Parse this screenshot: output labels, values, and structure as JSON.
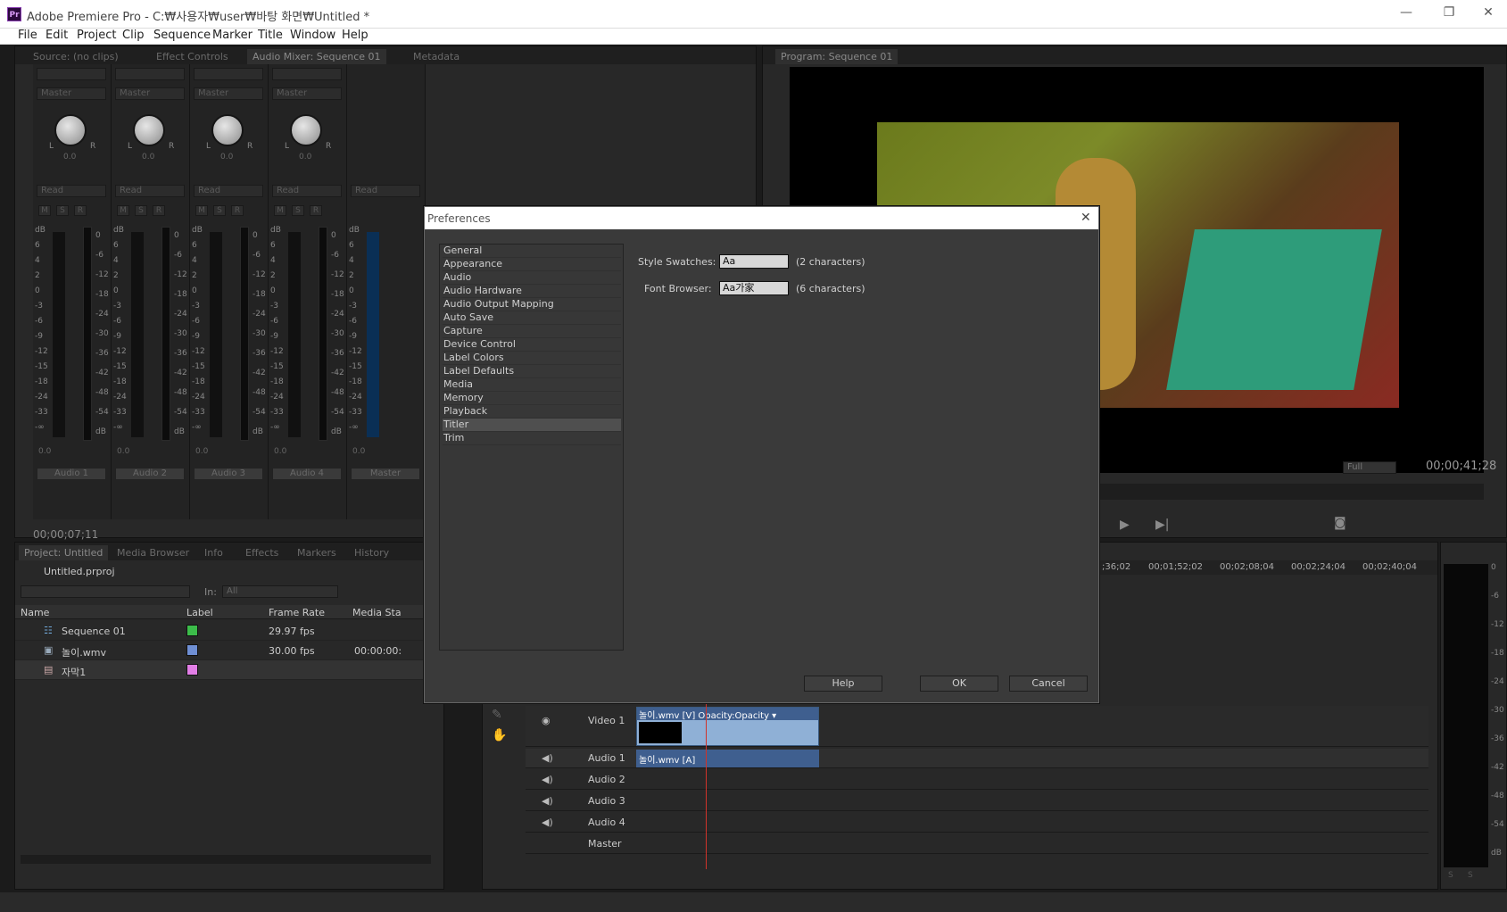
{
  "window": {
    "title": "Adobe Premiere Pro - C:₩사용자₩user₩바탕 화면₩Untitled *",
    "logo": "Pr",
    "minimize": "—",
    "restore": "❐",
    "close": "✕"
  },
  "menu": [
    "File",
    "Edit",
    "Project",
    "Clip",
    "Sequence",
    "Marker",
    "Title",
    "Window",
    "Help"
  ],
  "top_left_tabs": [
    "Source: (no clips)",
    "Effect Controls",
    "Audio Mixer: Sequence 01",
    "Metadata"
  ],
  "mixer": {
    "channels": [
      {
        "name": "Audio 1",
        "route": "Master",
        "automation": "Read",
        "pan": "0.0",
        "fader": "0.0"
      },
      {
        "name": "Audio 2",
        "route": "Master",
        "automation": "Read",
        "pan": "0.0",
        "fader": "0.0"
      },
      {
        "name": "Audio 3",
        "route": "Master",
        "automation": "Read",
        "pan": "0.0",
        "fader": "0.0"
      },
      {
        "name": "Audio 4",
        "route": "Master",
        "automation": "Read",
        "pan": "0.0",
        "fader": "0.0"
      },
      {
        "name": "Master",
        "route": "",
        "automation": "Read",
        "pan": "",
        "fader": "0.0"
      }
    ],
    "msr": [
      "M",
      "S",
      "R"
    ],
    "fader_scale": [
      "dB",
      "6",
      "4",
      "2",
      "0",
      "-3",
      "-6",
      "-9",
      "-12",
      "-15",
      "-18",
      "-24",
      "-33",
      "-∞"
    ],
    "meter_scale": [
      "0",
      "-6",
      "-12",
      "-18",
      "-24",
      "-30",
      "-36",
      "-42",
      "-48",
      "-54",
      "dB"
    ],
    "pan_l": "L",
    "pan_r": "R",
    "timecode": "00;00;07;11"
  },
  "program": {
    "tab": "Program: Sequence 01",
    "timecode": "00;00;41;28",
    "zoom": "Full"
  },
  "project": {
    "tabs": [
      "Project: Untitled",
      "Media Browser",
      "Info",
      "Effects",
      "Markers",
      "History"
    ],
    "file": "Untitled.prproj",
    "in_label": "In:",
    "in_value": "All",
    "columns": [
      "Name",
      "Label",
      "Frame Rate",
      "Media Sta"
    ],
    "rows": [
      {
        "name": "Sequence 01",
        "color": "#3cbc4a",
        "rate": "29.97 fps",
        "start": ""
      },
      {
        "name": "놀이.wmv",
        "color": "#6f8fd4",
        "rate": "30.00 fps",
        "start": "00:00:00:"
      },
      {
        "name": "자막1",
        "color": "#e27ee6",
        "rate": "",
        "start": ""
      }
    ]
  },
  "timeline": {
    "ruler": [
      ";36;02",
      "00;01;52;02",
      "00;02;08;04",
      "00;02;24;04",
      "00;02;40;04"
    ],
    "tracks": [
      "Video 1",
      "Audio 1",
      "Audio 2",
      "Audio 3",
      "Audio 4",
      "Master"
    ],
    "video_clip": "놀이.wmv [V]  Opacity:Opacity ▾",
    "audio_clip": "놀이.wmv [A]",
    "right_meter_scale": [
      "0",
      "-6",
      "-12",
      "-18",
      "-24",
      "-30",
      "-36",
      "-42",
      "-48",
      "-54",
      "dB"
    ],
    "right_meter_btns": [
      "S",
      "S"
    ]
  },
  "preferences": {
    "title": "Preferences",
    "close": "✕",
    "categories": [
      "General",
      "Appearance",
      "Audio",
      "Audio Hardware",
      "Audio Output Mapping",
      "Auto Save",
      "Capture",
      "Device Control",
      "Label Colors",
      "Label Defaults",
      "Media",
      "Memory",
      "Playback",
      "Titler",
      "Trim"
    ],
    "selected": "Titler",
    "style_swatches_label": "Style Swatches:",
    "style_swatches_value": "Aa",
    "style_swatches_hint": "(2 characters)",
    "font_browser_label": "Font Browser:",
    "font_browser_value": "Aa가家",
    "font_browser_hint": "(6 characters)",
    "help": "Help",
    "ok": "OK",
    "cancel": "Cancel"
  }
}
